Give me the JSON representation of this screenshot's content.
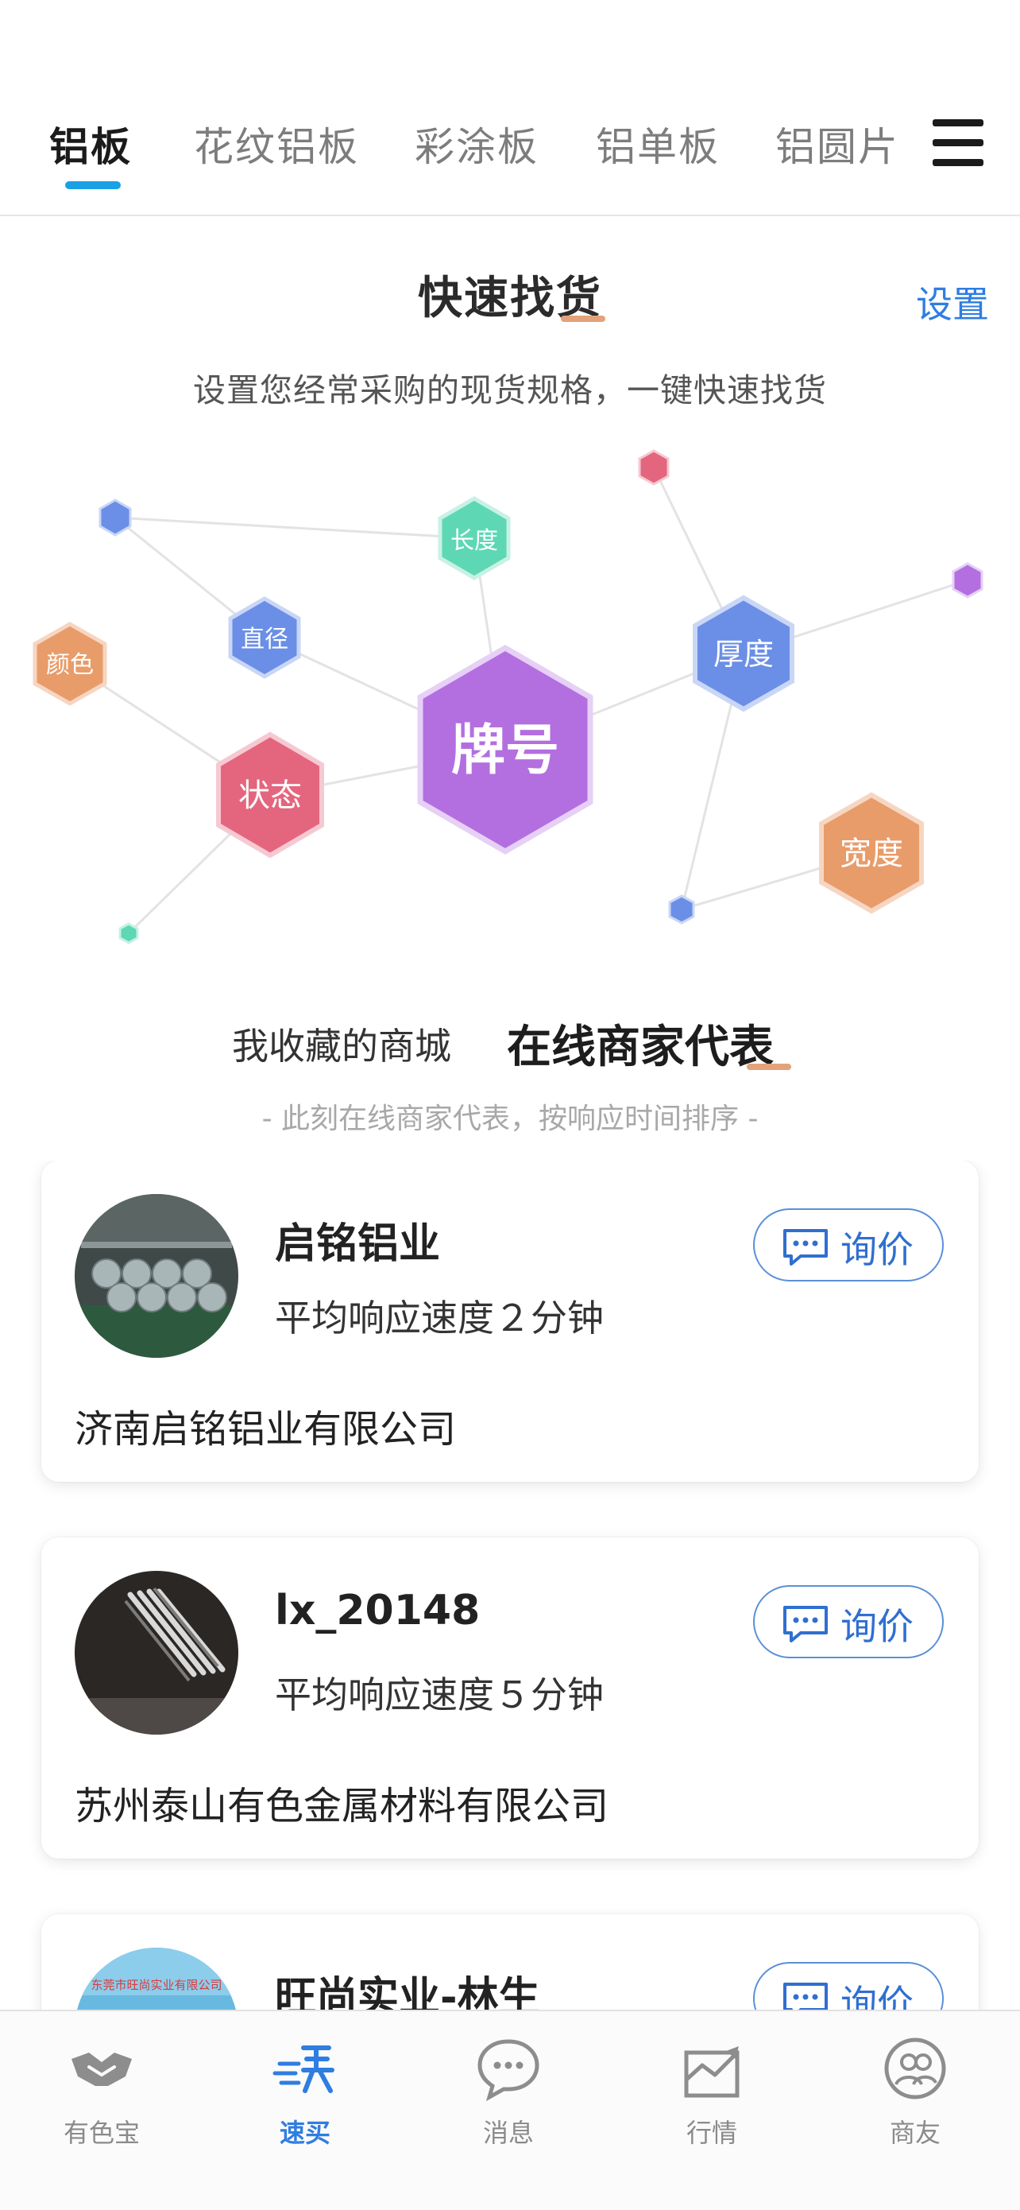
{
  "category_tabs": [
    "铝板",
    "花纹铝板",
    "彩涂板",
    "铝单板",
    "铝圆片"
  ],
  "quick_find": {
    "title": "快速找货",
    "settings_label": "设置",
    "subtitle": "设置您经常采购的现货规格，一键快速找货"
  },
  "spec_nodes": {
    "grade": "牌号",
    "thickness": "厚度",
    "width": "宽度",
    "length": "长度",
    "diameter": "直径",
    "temper": "状态",
    "color": "颜色"
  },
  "colors": {
    "accent_blue": "#2f7de1",
    "tab_underline": "#1aa0e6",
    "title_underline": "#e3a27a",
    "node_purple": "#b36fe0",
    "node_blue": "#6b8fe6",
    "node_orange": "#e89c6a",
    "node_green": "#5ed8b4",
    "node_pink": "#e4667e"
  },
  "section": {
    "tab_favorites": "我收藏的商城",
    "tab_online": "在线商家代表",
    "subtitle": "- 此刻在线商家代表，按响应时间排序 -"
  },
  "merchants": [
    {
      "name": "启铭铝业",
      "speed": "平均响应速度２分钟",
      "company": "济南启铭铝业有限公司",
      "inquiry_label": "询价",
      "avatar_icon": "warehouse-photo"
    },
    {
      "name": "lx_20148",
      "speed": "平均响应速度５分钟",
      "company": "苏州泰山有色金属材料有限公司",
      "inquiry_label": "询价",
      "avatar_icon": "aluminum-coil-photo"
    },
    {
      "name": "旺尚实业-林生",
      "speed": "",
      "company": "",
      "inquiry_label": "询价",
      "avatar_icon": "company-banner-photo",
      "avatar_text": "东莞市旺尚实业有限公司"
    }
  ],
  "bottom_nav": [
    {
      "label": "有色宝",
      "icon": "handshake-icon",
      "active": false
    },
    {
      "label": "速买",
      "icon": "quick-buy-icon",
      "active": true
    },
    {
      "label": "消息",
      "icon": "chat-bubble-icon",
      "active": false
    },
    {
      "label": "行情",
      "icon": "trend-chart-icon",
      "active": false
    },
    {
      "label": "商友",
      "icon": "friends-icon",
      "active": false
    }
  ]
}
